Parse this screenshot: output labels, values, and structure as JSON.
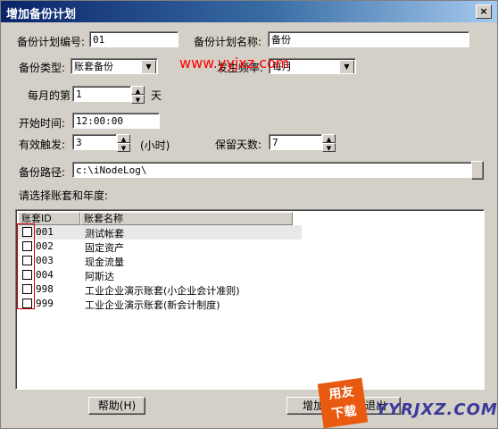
{
  "window": {
    "title": "增加备份计划",
    "close_glyph": "×"
  },
  "form": {
    "plan_no_label": "备份计划编号:",
    "plan_no_value": "01",
    "plan_name_label": "备份计划名称:",
    "plan_name_value": "备份",
    "backup_type_label": "备份类型:",
    "backup_type_value": "账套备份",
    "frequency_label": "发生频率:",
    "frequency_value": "每月",
    "day_label": "每月的第",
    "day_value": "1",
    "day_unit": "天",
    "start_time_label": "开始时间:",
    "start_time_value": "12:00:00",
    "trigger_label": "有效触发:",
    "trigger_value": "3",
    "trigger_unit": "(小时)",
    "keep_days_label": "保留天数:",
    "keep_days_value": "7",
    "path_label": "备份路径:",
    "path_value": "c:\\iNodeLog\\",
    "select_label": "请选择账套和年度:"
  },
  "table": {
    "headers": [
      "账套ID",
      "账套名称"
    ],
    "rows": [
      {
        "id": "001",
        "name": "测试帐套",
        "checked": false
      },
      {
        "id": "002",
        "name": "固定资产",
        "checked": false
      },
      {
        "id": "003",
        "name": "现金流量",
        "checked": false
      },
      {
        "id": "004",
        "name": "阿斯达",
        "checked": false
      },
      {
        "id": "998",
        "name": "工业企业演示账套(小企业会计准则)",
        "checked": false
      },
      {
        "id": "999",
        "name": "工业企业演示账套(新会计制度)",
        "checked": false
      }
    ]
  },
  "buttons": {
    "help": "帮助(H)",
    "add": "增加",
    "exit": "退出"
  },
  "watermark": {
    "url": "www.yyjxz.com",
    "logo_top": "用友",
    "logo_bottom": "下载",
    "site": "YYRJXZ.COM",
    "red": "#ff0000"
  }
}
